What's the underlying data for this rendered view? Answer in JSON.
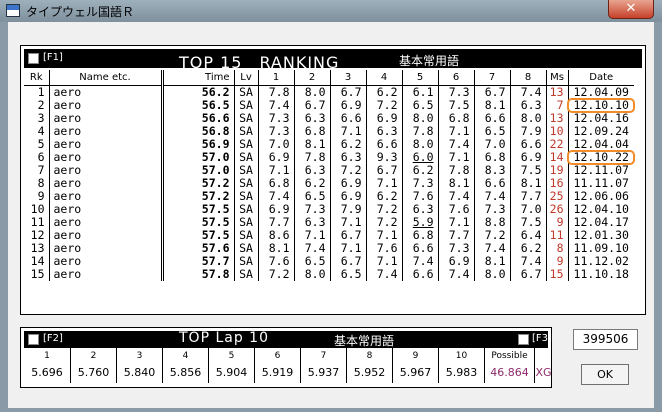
{
  "window": {
    "title": "タイプウェル国語Ｒ",
    "close_glyph": "✕"
  },
  "ranking": {
    "fkey": "[F1]",
    "title": "TOP 15　RANKING",
    "subtitle": "基本常用語",
    "columns": [
      "Rk",
      "Name etc.",
      "Time",
      "Lv",
      "1",
      "2",
      "3",
      "4",
      "5",
      "6",
      "7",
      "8",
      "Ms",
      "Date"
    ],
    "rows": [
      {
        "rk": "1",
        "name": "aero",
        "time": "56.2",
        "lv": "SA",
        "laps": [
          "7.8",
          "8.0",
          "6.7",
          "6.2",
          "6.1",
          "7.3",
          "6.7",
          "7.4"
        ],
        "ms": "13",
        "date": "12.04.09"
      },
      {
        "rk": "2",
        "name": "aero",
        "time": "56.5",
        "lv": "SA",
        "laps": [
          "7.4",
          "6.7",
          "6.9",
          "7.2",
          "6.5",
          "7.5",
          "8.1",
          "6.3"
        ],
        "ms": "7",
        "date": "12.10.10"
      },
      {
        "rk": "3",
        "name": "aero",
        "time": "56.6",
        "lv": "SA",
        "laps": [
          "7.3",
          "6.3",
          "6.6",
          "6.9",
          "8.0",
          "6.8",
          "6.6",
          "8.0"
        ],
        "ms": "13",
        "date": "12.04.16"
      },
      {
        "rk": "4",
        "name": "aero",
        "time": "56.8",
        "lv": "SA",
        "laps": [
          "7.3",
          "6.8",
          "7.1",
          "6.3",
          "7.8",
          "7.1",
          "6.5",
          "7.9"
        ],
        "ms": "10",
        "date": "12.09.24"
      },
      {
        "rk": "5",
        "name": "aero",
        "time": "56.9",
        "lv": "SA",
        "laps": [
          "7.0",
          "8.1",
          "6.2",
          "6.6",
          "8.0",
          "7.4",
          "7.0",
          "6.6"
        ],
        "ms": "22",
        "date": "12.04.04"
      },
      {
        "rk": "6",
        "name": "aero",
        "time": "57.0",
        "lv": "SA",
        "laps": [
          "6.9",
          "7.8",
          "6.3",
          "9.3",
          "6.0",
          "7.1",
          "6.8",
          "6.9"
        ],
        "ms": "14",
        "date": "12.10.22"
      },
      {
        "rk": "7",
        "name": "aero",
        "time": "57.0",
        "lv": "SA",
        "laps": [
          "7.1",
          "6.3",
          "7.2",
          "6.7",
          "6.2",
          "7.8",
          "8.3",
          "7.5"
        ],
        "ms": "19",
        "date": "12.11.07"
      },
      {
        "rk": "8",
        "name": "aero",
        "time": "57.2",
        "lv": "SA",
        "laps": [
          "6.8",
          "6.2",
          "6.9",
          "7.1",
          "7.3",
          "8.1",
          "6.6",
          "8.1"
        ],
        "ms": "16",
        "date": "11.11.07"
      },
      {
        "rk": "9",
        "name": "aero",
        "time": "57.2",
        "lv": "SA",
        "laps": [
          "7.4",
          "6.5",
          "6.9",
          "6.2",
          "7.6",
          "7.4",
          "7.4",
          "7.7"
        ],
        "ms": "25",
        "date": "12.06.06"
      },
      {
        "rk": "10",
        "name": "aero",
        "time": "57.5",
        "lv": "SA",
        "laps": [
          "6.9",
          "7.3",
          "7.9",
          "7.2",
          "6.3",
          "7.6",
          "7.3",
          "7.0"
        ],
        "ms": "26",
        "date": "12.04.10"
      },
      {
        "rk": "11",
        "name": "aero",
        "time": "57.5",
        "lv": "SA",
        "laps": [
          "7.7",
          "6.3",
          "7.1",
          "7.2",
          "5.9",
          "7.1",
          "8.8",
          "7.5"
        ],
        "ms": "9",
        "date": "12.04.17"
      },
      {
        "rk": "12",
        "name": "aero",
        "time": "57.5",
        "lv": "SA",
        "laps": [
          "8.6",
          "7.1",
          "6.7",
          "7.1",
          "6.8",
          "7.7",
          "7.2",
          "6.4"
        ],
        "ms": "11",
        "date": "12.01.30"
      },
      {
        "rk": "13",
        "name": "aero",
        "time": "57.6",
        "lv": "SA",
        "laps": [
          "8.1",
          "7.4",
          "7.1",
          "7.6",
          "6.6",
          "7.3",
          "7.4",
          "6.2"
        ],
        "ms": "8",
        "date": "11.09.10"
      },
      {
        "rk": "14",
        "name": "aero",
        "time": "57.7",
        "lv": "SA",
        "laps": [
          "7.6",
          "6.5",
          "6.7",
          "7.1",
          "7.4",
          "6.9",
          "8.1",
          "7.4"
        ],
        "ms": "9",
        "date": "11.12.02"
      },
      {
        "rk": "15",
        "name": "aero",
        "time": "57.8",
        "lv": "SA",
        "laps": [
          "7.2",
          "8.0",
          "6.5",
          "7.4",
          "6.6",
          "7.4",
          "8.0",
          "6.7"
        ],
        "ms": "15",
        "date": "11.10.18"
      }
    ]
  },
  "top_lap": {
    "fkey_left": "[F2]",
    "title": "TOP Lap 10",
    "subtitle": "基本常用語",
    "fkey_right": "[F3]",
    "labels": [
      "1",
      "2",
      "3",
      "4",
      "5",
      "6",
      "7",
      "8",
      "9",
      "10"
    ],
    "values": [
      "5.696",
      "5.760",
      "5.840",
      "5.856",
      "5.904",
      "5.919",
      "5.937",
      "5.952",
      "5.967",
      "5.983"
    ],
    "possible_label": "Possible",
    "possible_value": "46.864",
    "level": "XG"
  },
  "score": "399506",
  "ok_label": "OK"
}
